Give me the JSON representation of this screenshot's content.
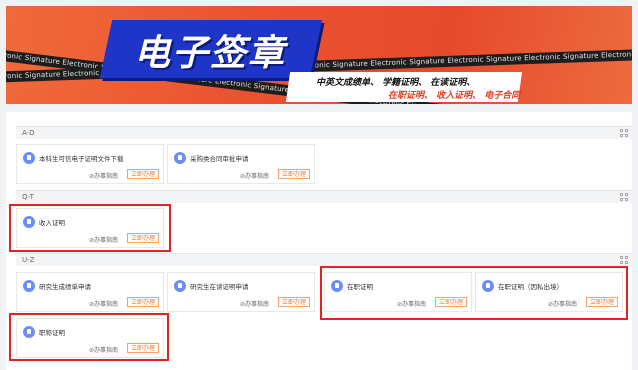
{
  "banner": {
    "bg_text": "Electronic Signature",
    "title": "电子签章",
    "tagline1": "中英文成绩单、 学籍证明、 在读证明、",
    "tagline2": "在职证明、 收入证明、 电子合同"
  },
  "sections": [
    {
      "label": "A-D",
      "cards": [
        {
          "label": "本科生可信电子证明文件下载",
          "guide": "办事指南",
          "apply": "立即办理"
        },
        {
          "label": "采购类合同审批申请",
          "guide": "办事指南",
          "apply": "立即办理"
        }
      ]
    },
    {
      "label": "Q-T",
      "cards": [
        {
          "label": "收入证明",
          "guide": "办事指南",
          "apply": "立即办理"
        }
      ]
    },
    {
      "label": "U-Z",
      "cards": [
        {
          "label": "研究生成绩单申请",
          "guide": "办事指南",
          "apply": "立即办理"
        },
        {
          "label": "研究生在读证明申请",
          "guide": "办事指南",
          "apply": "立即办理"
        },
        {
          "label": "在职证明",
          "guide": "办事指南",
          "apply": "立即办理"
        },
        {
          "label": "在职证明（因私出境）",
          "guide": "办事指南",
          "apply": "立即办理"
        },
        {
          "label": "职称证明",
          "guide": "办事指南",
          "apply": "立即办理"
        }
      ]
    }
  ],
  "colors": {
    "banner": "#e64a2b",
    "block": "#1f35c8",
    "accent": "#f07b32",
    "highlight": "#e02424",
    "icon": "#6b8df5"
  }
}
